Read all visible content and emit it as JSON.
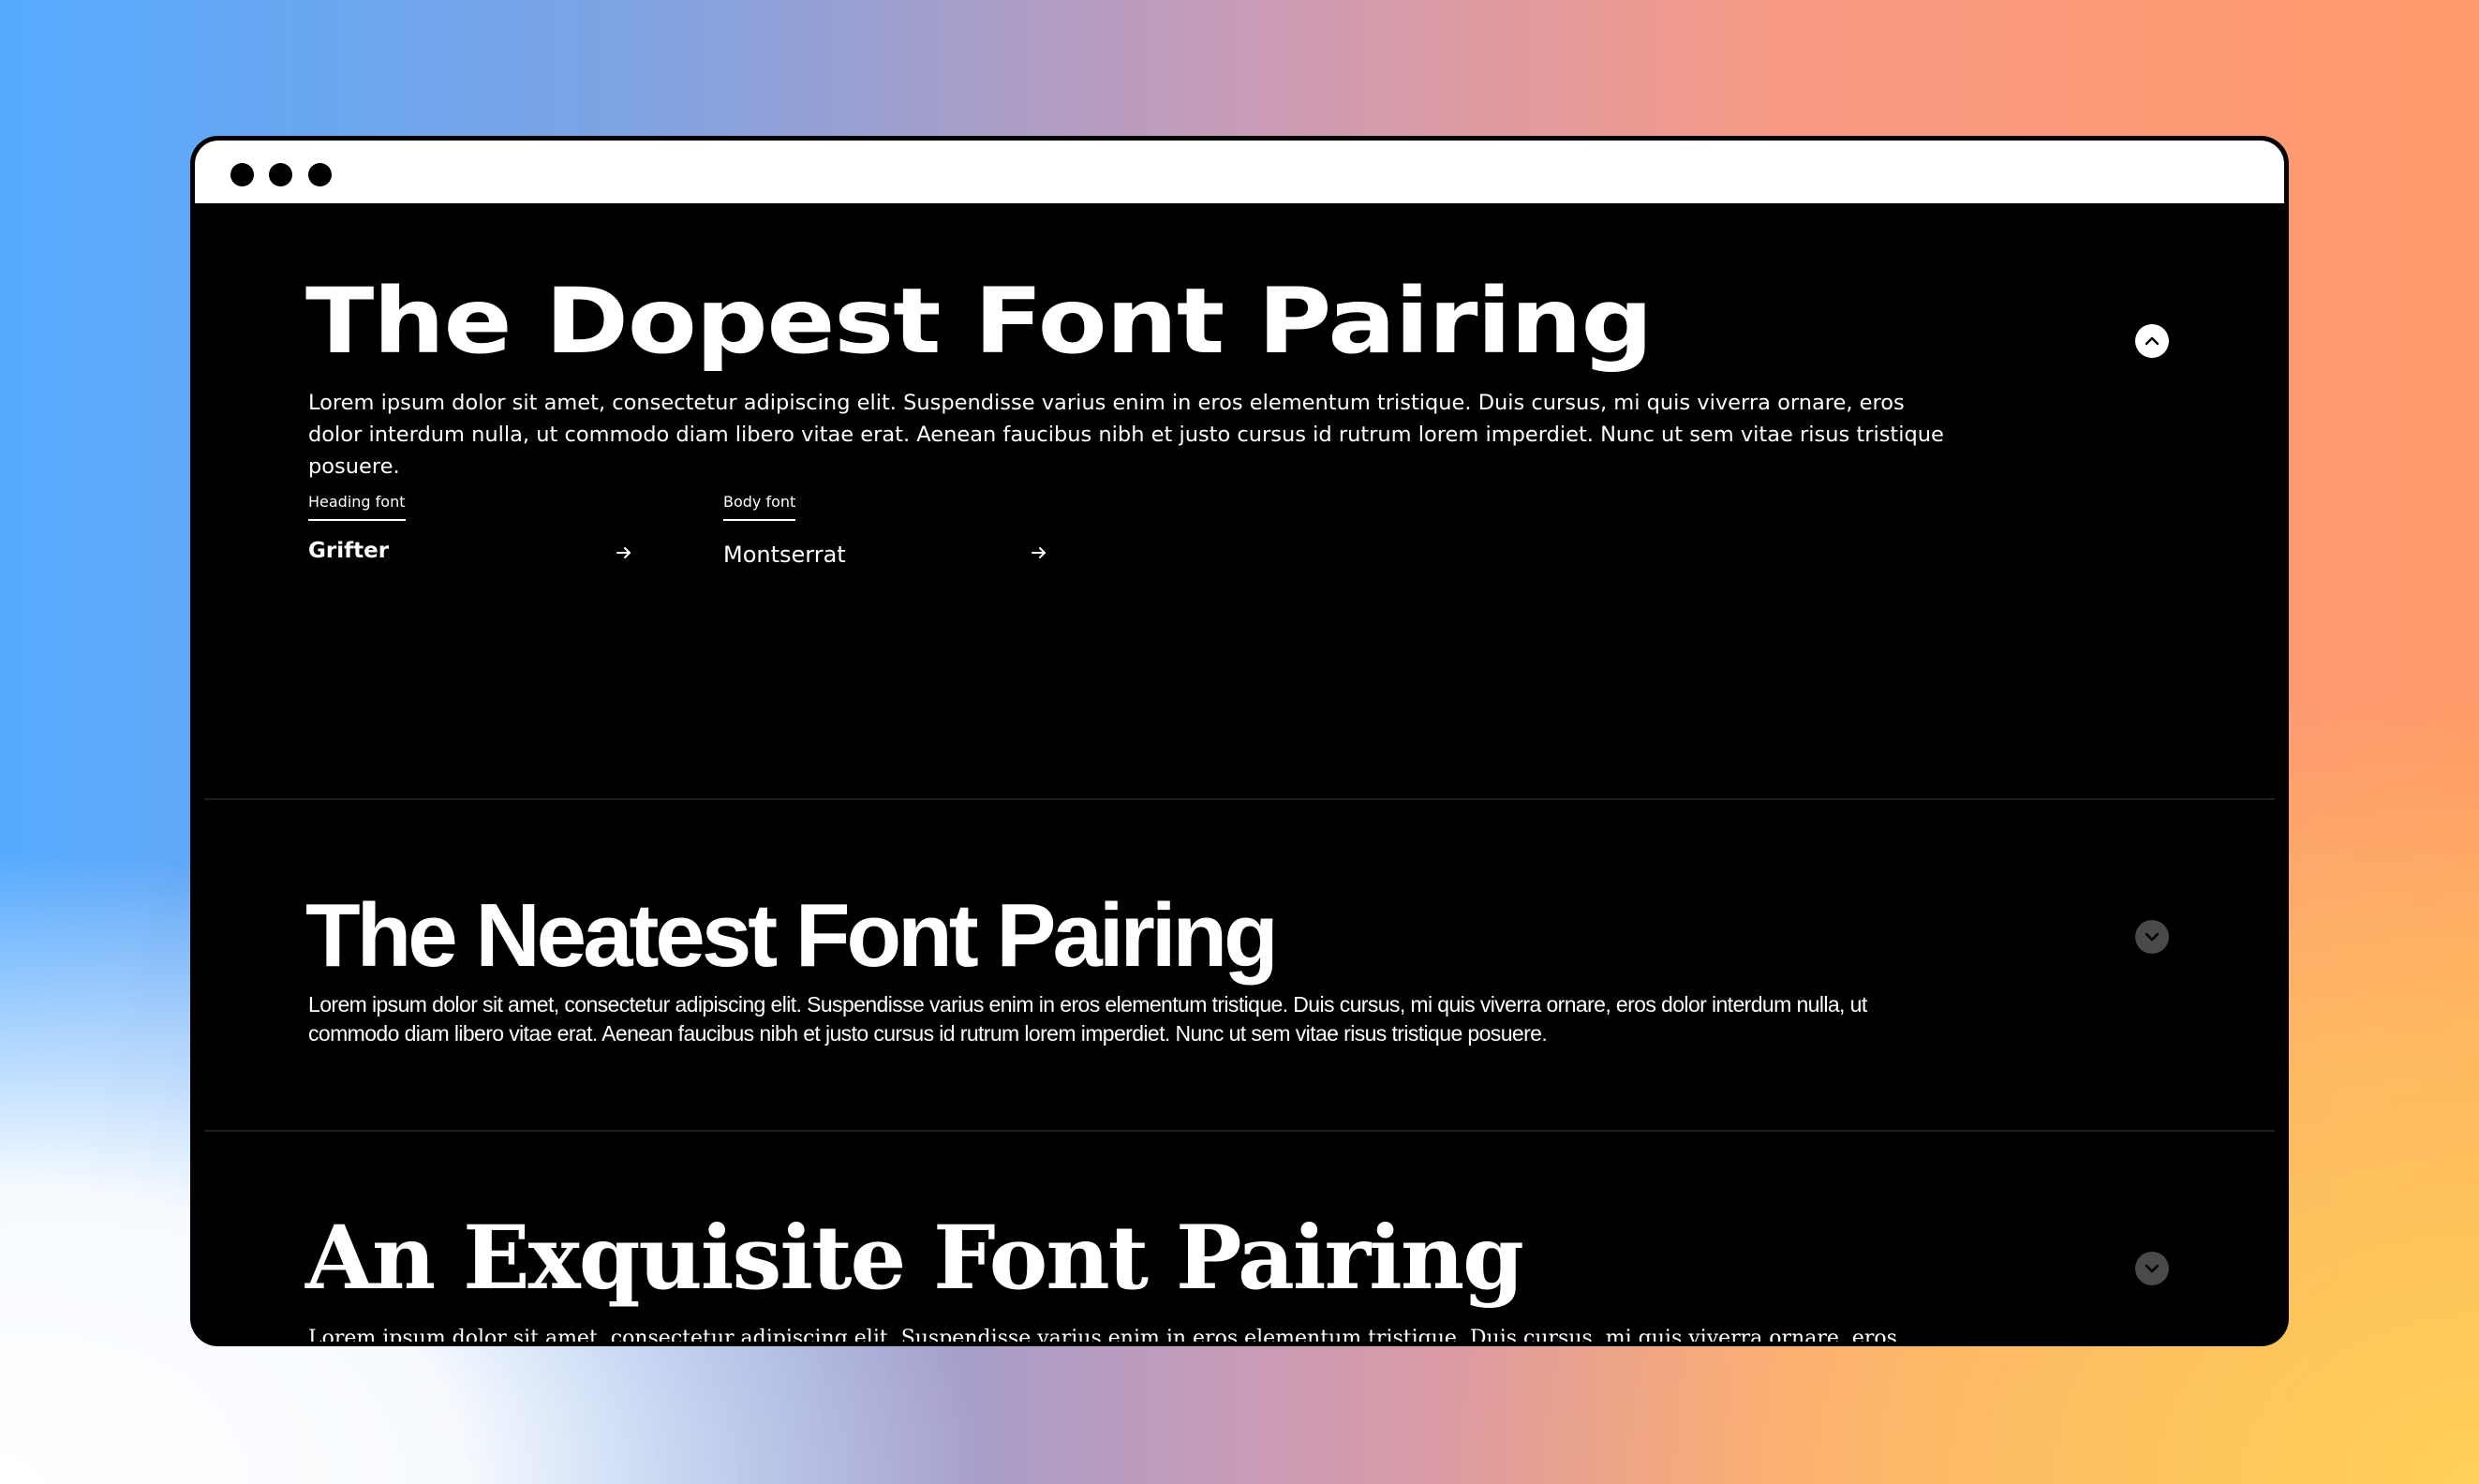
{
  "window": {
    "controls": [
      "dot",
      "dot",
      "dot"
    ]
  },
  "pairings": [
    {
      "heading": "The Dopest Font Pairing",
      "body": "Lorem ipsum dolor sit amet, consectetur adipiscing elit. Suspendisse varius enim in eros elementum tristique. Duis cursus, mi quis viverra ornare, eros dolor interdum nulla, ut commodo diam libero vitae erat. Aenean faucibus nibh et justo cursus id rutrum lorem imperdiet. Nunc ut sem vitae risus tristique posuere.",
      "expanded": true,
      "toggle_icon": "chevron-up-icon",
      "heading_font": {
        "label": "Heading font",
        "name": "Grifter",
        "arrow_icon": "arrow-right-icon"
      },
      "body_font": {
        "label": "Body font",
        "name": "Montserrat",
        "arrow_icon": "arrow-right-icon"
      }
    },
    {
      "heading": "The Neatest Font Pairing",
      "body": "Lorem ipsum dolor sit amet, consectetur adipiscing elit. Suspendisse varius enim in eros elementum tristique. Duis cursus, mi quis viverra ornare, eros dolor interdum nulla, ut commodo diam libero vitae erat. Aenean faucibus nibh et justo cursus id rutrum lorem imperdiet. Nunc ut sem vitae risus tristique posuere.",
      "expanded": false,
      "toggle_icon": "chevron-down-icon"
    },
    {
      "heading": "An Exquisite Font Pairing",
      "body": "Lorem ipsum dolor sit amet, consectetur adipiscing elit. Suspendisse varius enim in eros elementum tristique. Duis cursus, mi quis viverra ornare, eros dolor interdum nulla, ut commodo diam libero vitae erat. Aenean faucibus nibh et justo cursus id rutrum lorem imperdiet. Nunc ut sem vitae risus tristique posuere.",
      "expanded": false,
      "toggle_icon": "chevron-down-icon"
    }
  ],
  "colors": {
    "panel": "#000000",
    "text": "#ffffff",
    "toggle_open": "#ffffff",
    "toggle_closed": "#4a4a4a",
    "divider": "#1f1f1f",
    "bg_gradient": [
      "#55aaff",
      "#c89bb7",
      "#ff9a6a",
      "#ffd057",
      "#ffffff"
    ]
  }
}
